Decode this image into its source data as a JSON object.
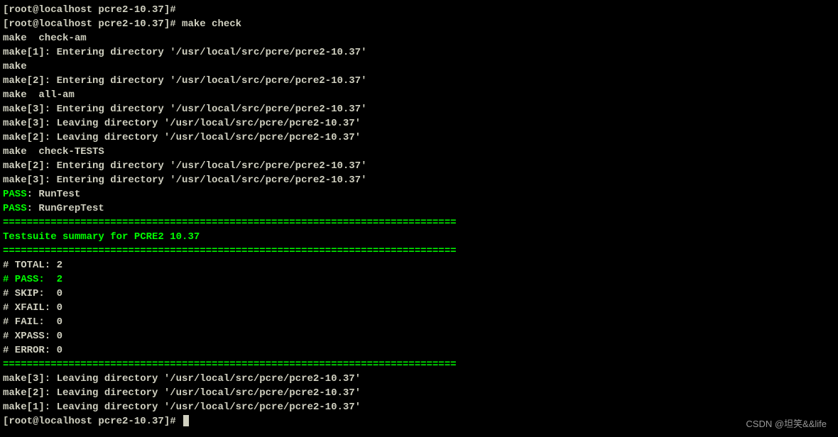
{
  "lines": [
    {
      "segments": [
        {
          "text": "[root@localhost pcre2-10.37]#",
          "cls": ""
        }
      ]
    },
    {
      "segments": [
        {
          "text": "[root@localhost pcre2-10.37]# make check",
          "cls": ""
        }
      ]
    },
    {
      "segments": [
        {
          "text": "make  check-am",
          "cls": ""
        }
      ]
    },
    {
      "segments": [
        {
          "text": "make[1]: Entering directory '/usr/local/src/pcre/pcre2-10.37'",
          "cls": ""
        }
      ]
    },
    {
      "segments": [
        {
          "text": "make",
          "cls": ""
        }
      ]
    },
    {
      "segments": [
        {
          "text": "make[2]: Entering directory '/usr/local/src/pcre/pcre2-10.37'",
          "cls": ""
        }
      ]
    },
    {
      "segments": [
        {
          "text": "make  all-am",
          "cls": ""
        }
      ]
    },
    {
      "segments": [
        {
          "text": "make[3]: Entering directory '/usr/local/src/pcre/pcre2-10.37'",
          "cls": ""
        }
      ]
    },
    {
      "segments": [
        {
          "text": "make[3]: Leaving directory '/usr/local/src/pcre/pcre2-10.37'",
          "cls": ""
        }
      ]
    },
    {
      "segments": [
        {
          "text": "make[2]: Leaving directory '/usr/local/src/pcre/pcre2-10.37'",
          "cls": ""
        }
      ]
    },
    {
      "segments": [
        {
          "text": "make  check-TESTS",
          "cls": ""
        }
      ]
    },
    {
      "segments": [
        {
          "text": "make[2]: Entering directory '/usr/local/src/pcre/pcre2-10.37'",
          "cls": ""
        }
      ]
    },
    {
      "segments": [
        {
          "text": "make[3]: Entering directory '/usr/local/src/pcre/pcre2-10.37'",
          "cls": ""
        }
      ]
    },
    {
      "segments": [
        {
          "text": "PASS",
          "cls": "green"
        },
        {
          "text": ": RunTest",
          "cls": ""
        }
      ]
    },
    {
      "segments": [
        {
          "text": "PASS",
          "cls": "green"
        },
        {
          "text": ": RunGrepTest",
          "cls": ""
        }
      ]
    },
    {
      "segments": [
        {
          "text": "============================================================================",
          "cls": "green"
        }
      ]
    },
    {
      "segments": [
        {
          "text": "Testsuite summary for PCRE2 10.37",
          "cls": "green"
        }
      ]
    },
    {
      "segments": [
        {
          "text": "============================================================================",
          "cls": "green"
        }
      ]
    },
    {
      "segments": [
        {
          "text": "# TOTAL: 2",
          "cls": ""
        }
      ]
    },
    {
      "segments": [
        {
          "text": "# PASS:  2",
          "cls": "green"
        }
      ]
    },
    {
      "segments": [
        {
          "text": "# SKIP:  0",
          "cls": ""
        }
      ]
    },
    {
      "segments": [
        {
          "text": "# XFAIL: 0",
          "cls": ""
        }
      ]
    },
    {
      "segments": [
        {
          "text": "# FAIL:  0",
          "cls": ""
        }
      ]
    },
    {
      "segments": [
        {
          "text": "# XPASS: 0",
          "cls": ""
        }
      ]
    },
    {
      "segments": [
        {
          "text": "# ERROR: 0",
          "cls": ""
        }
      ]
    },
    {
      "segments": [
        {
          "text": "============================================================================",
          "cls": "green"
        }
      ]
    },
    {
      "segments": [
        {
          "text": "make[3]: Leaving directory '/usr/local/src/pcre/pcre2-10.37'",
          "cls": ""
        }
      ]
    },
    {
      "segments": [
        {
          "text": "make[2]: Leaving directory '/usr/local/src/pcre/pcre2-10.37'",
          "cls": ""
        }
      ]
    },
    {
      "segments": [
        {
          "text": "make[1]: Leaving directory '/usr/local/src/pcre/pcre2-10.37'",
          "cls": ""
        }
      ]
    },
    {
      "segments": [
        {
          "text": "[root@localhost pcre2-10.37]# ",
          "cls": ""
        }
      ],
      "cursor": true
    }
  ],
  "watermark": "CSDN @坦笑&&life"
}
